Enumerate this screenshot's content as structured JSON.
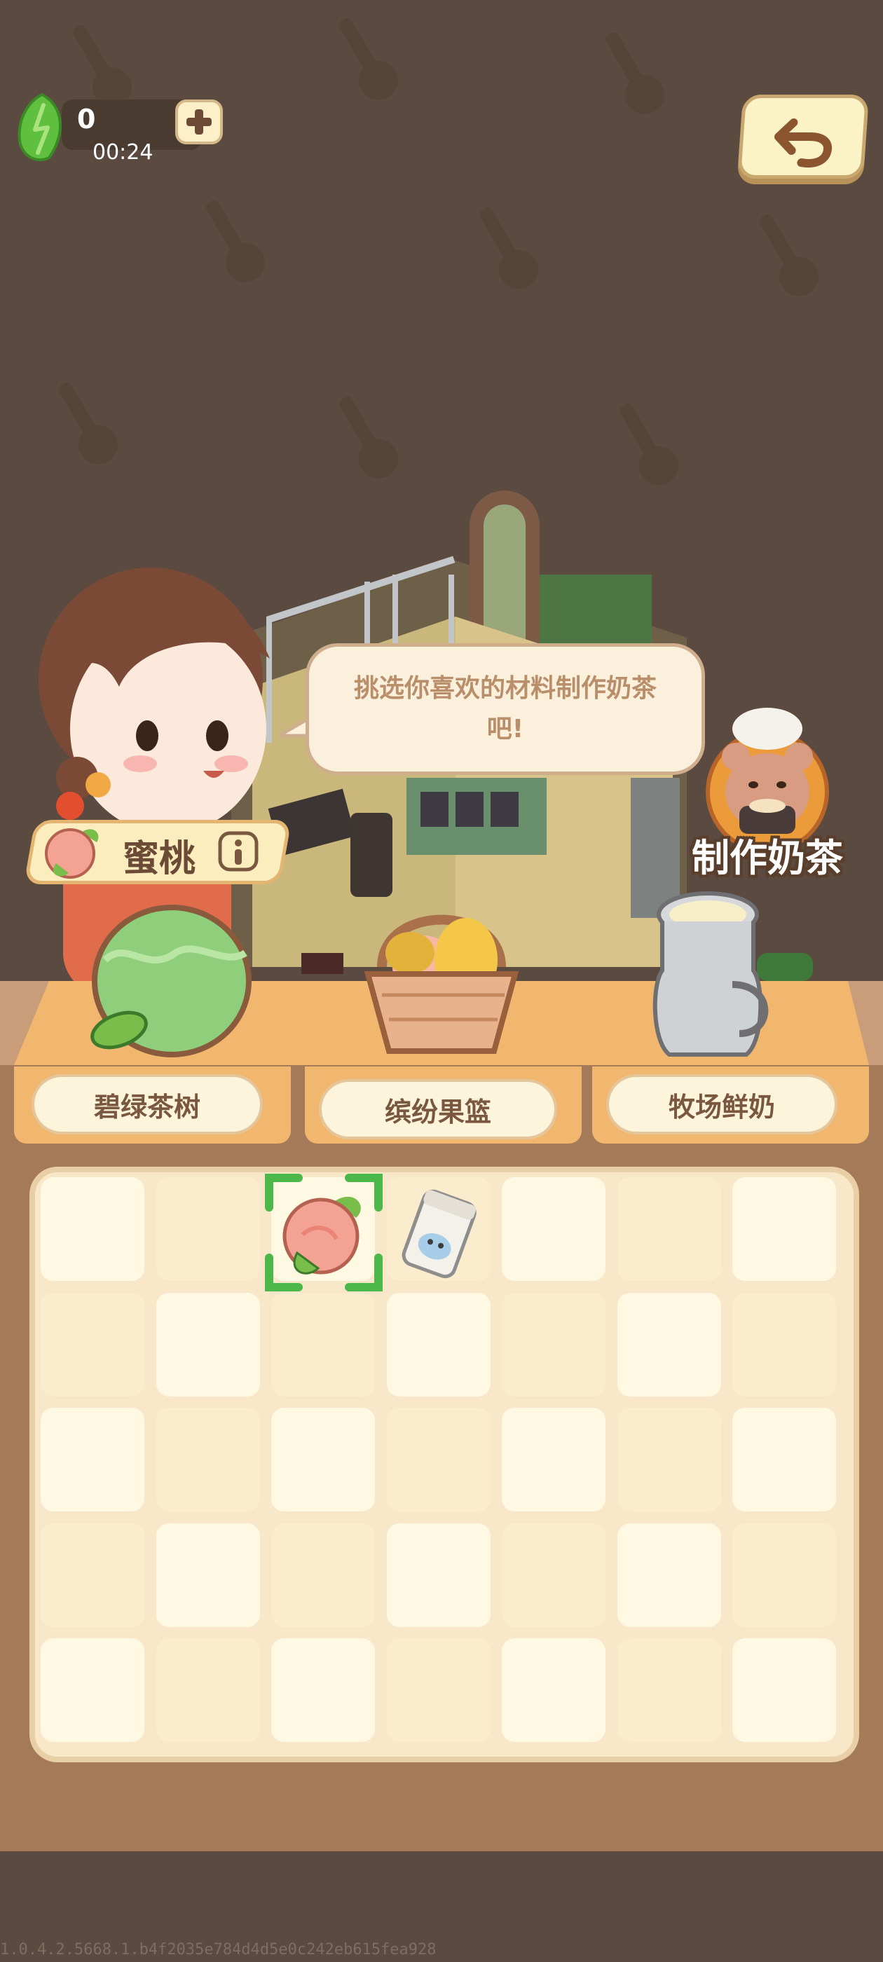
{
  "hud": {
    "energy_value": "0",
    "energy_timer": "00:24"
  },
  "dialog": {
    "text_line1": "挑选你喜欢的材料制作奶茶",
    "text_line2": "吧!"
  },
  "selected_item": {
    "name": "蜜桃"
  },
  "make_tea": {
    "label": "制作奶茶"
  },
  "stations": [
    {
      "label": "碧绿茶树"
    },
    {
      "label": "缤纷果篮"
    },
    {
      "label": "牧场鲜奶"
    }
  ],
  "inventory": {
    "rows": 5,
    "cols": 7,
    "items": [
      {
        "row": 0,
        "col": 2,
        "item": "peach",
        "selected": true
      },
      {
        "row": 0,
        "col": 3,
        "item": "milk-powder-bag",
        "selected": false
      }
    ]
  },
  "version": "1.0.4.2.5668.1.b4f2035e784d4d5e0c242eb615fea928",
  "colors": {
    "background": "#5a4a3f",
    "counter": "#f2b76e",
    "grid_board": "#f8e7c9",
    "selector": "#4cb84a"
  }
}
